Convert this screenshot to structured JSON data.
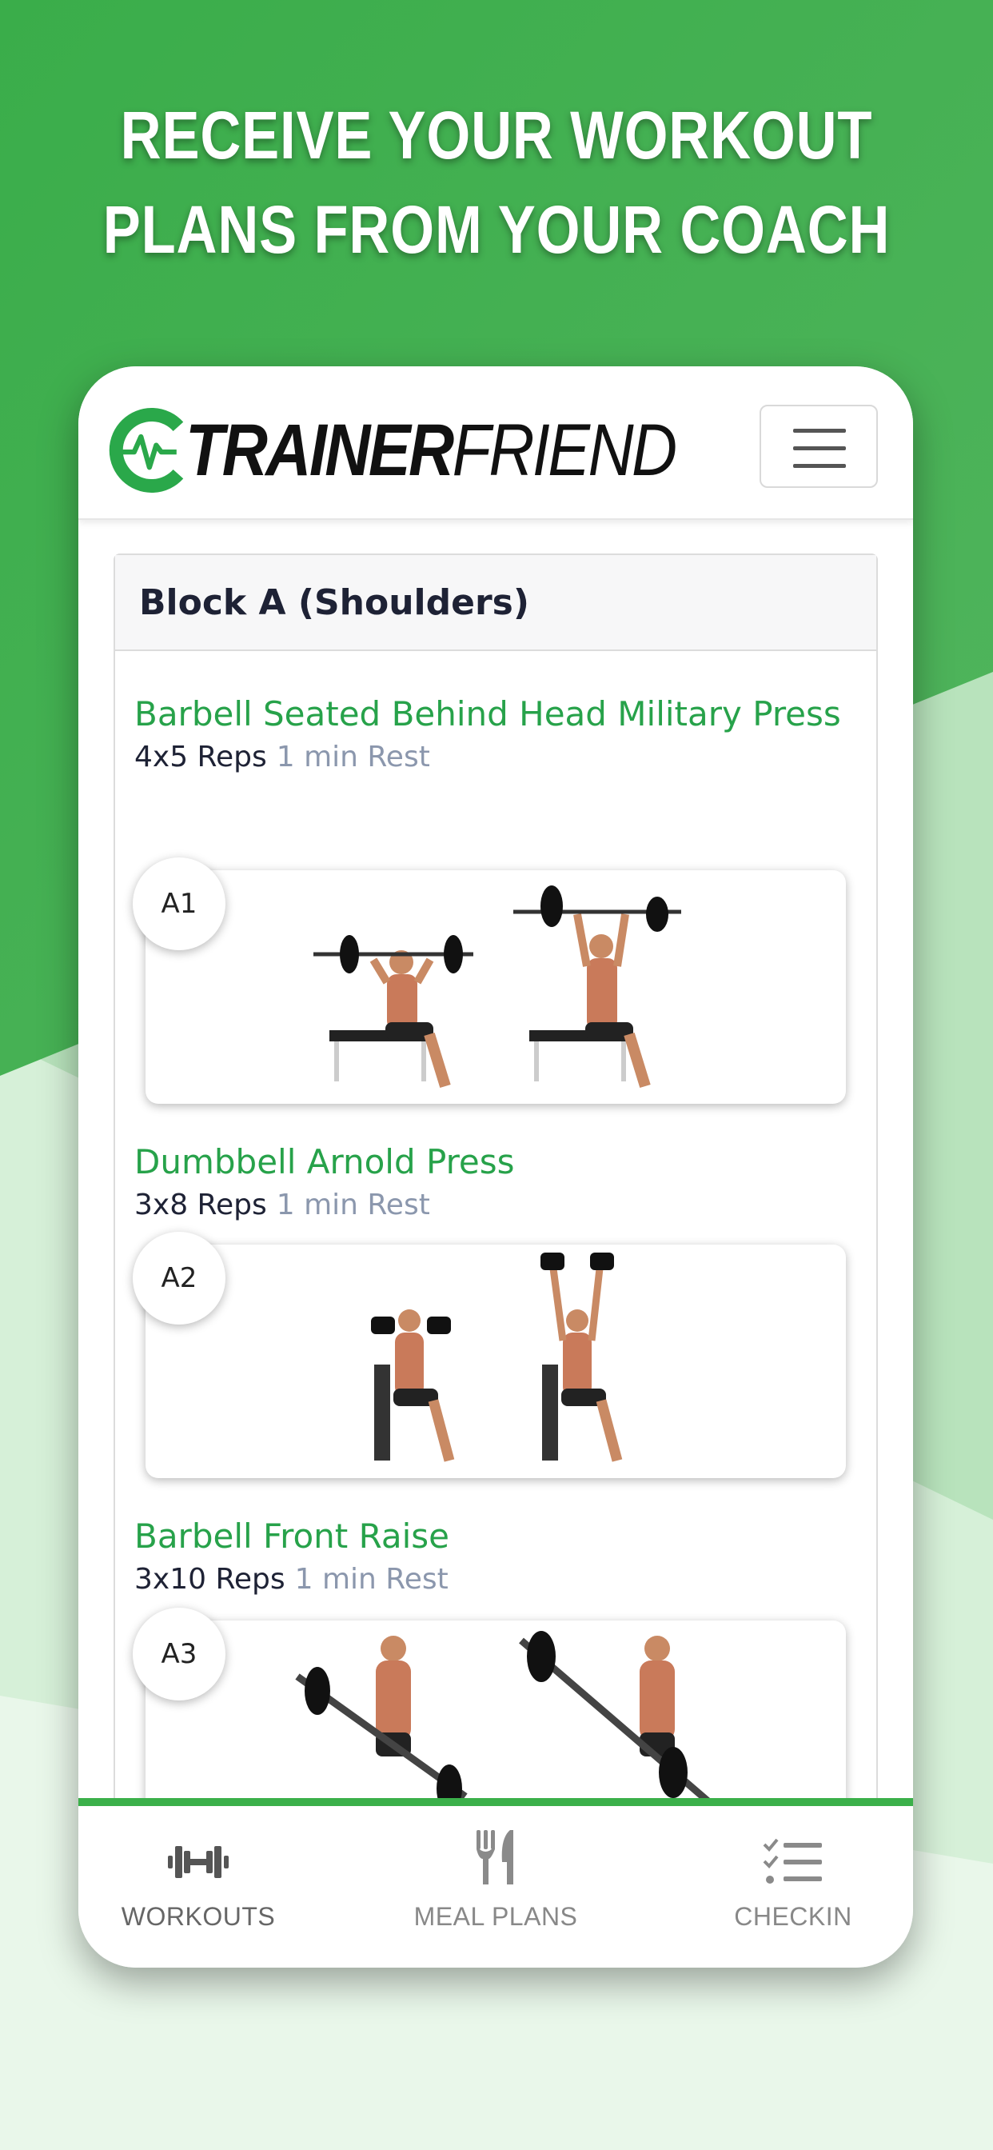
{
  "headline": {
    "line1": "RECEIVE YOUR WORKOUT",
    "line2": "PLANS FROM YOUR COACH"
  },
  "colors": {
    "brand_green": "#3bb04a",
    "title_green": "#27a24a",
    "rest_gray": "#8b97ad",
    "dark_text": "#1e2235"
  },
  "app": {
    "logo_bold": "TRAINER",
    "logo_light": "FRIEND",
    "menu_icon": "hamburger-icon"
  },
  "block": {
    "title": "Block A (Shoulders)",
    "exercises": [
      {
        "badge": "A1",
        "title": "Barbell Seated Behind Head Military Press",
        "reps": "4x5 Reps",
        "rest": "1 min Rest"
      },
      {
        "badge": "A2",
        "title": "Dumbbell Arnold Press",
        "reps": "3x8 Reps",
        "rest": "1 min Rest"
      },
      {
        "badge": "A3",
        "title": "Barbell Front Raise",
        "reps": "3x10 Reps",
        "rest": "1 min Rest"
      }
    ]
  },
  "nav": {
    "items": [
      {
        "label": "WORKOUTS",
        "icon": "dumbbell-icon",
        "active": true
      },
      {
        "label": "MEAL PLANS",
        "icon": "fork-knife-icon",
        "active": false
      },
      {
        "label": "CHECKIN",
        "icon": "checklist-icon",
        "active": false
      }
    ]
  }
}
